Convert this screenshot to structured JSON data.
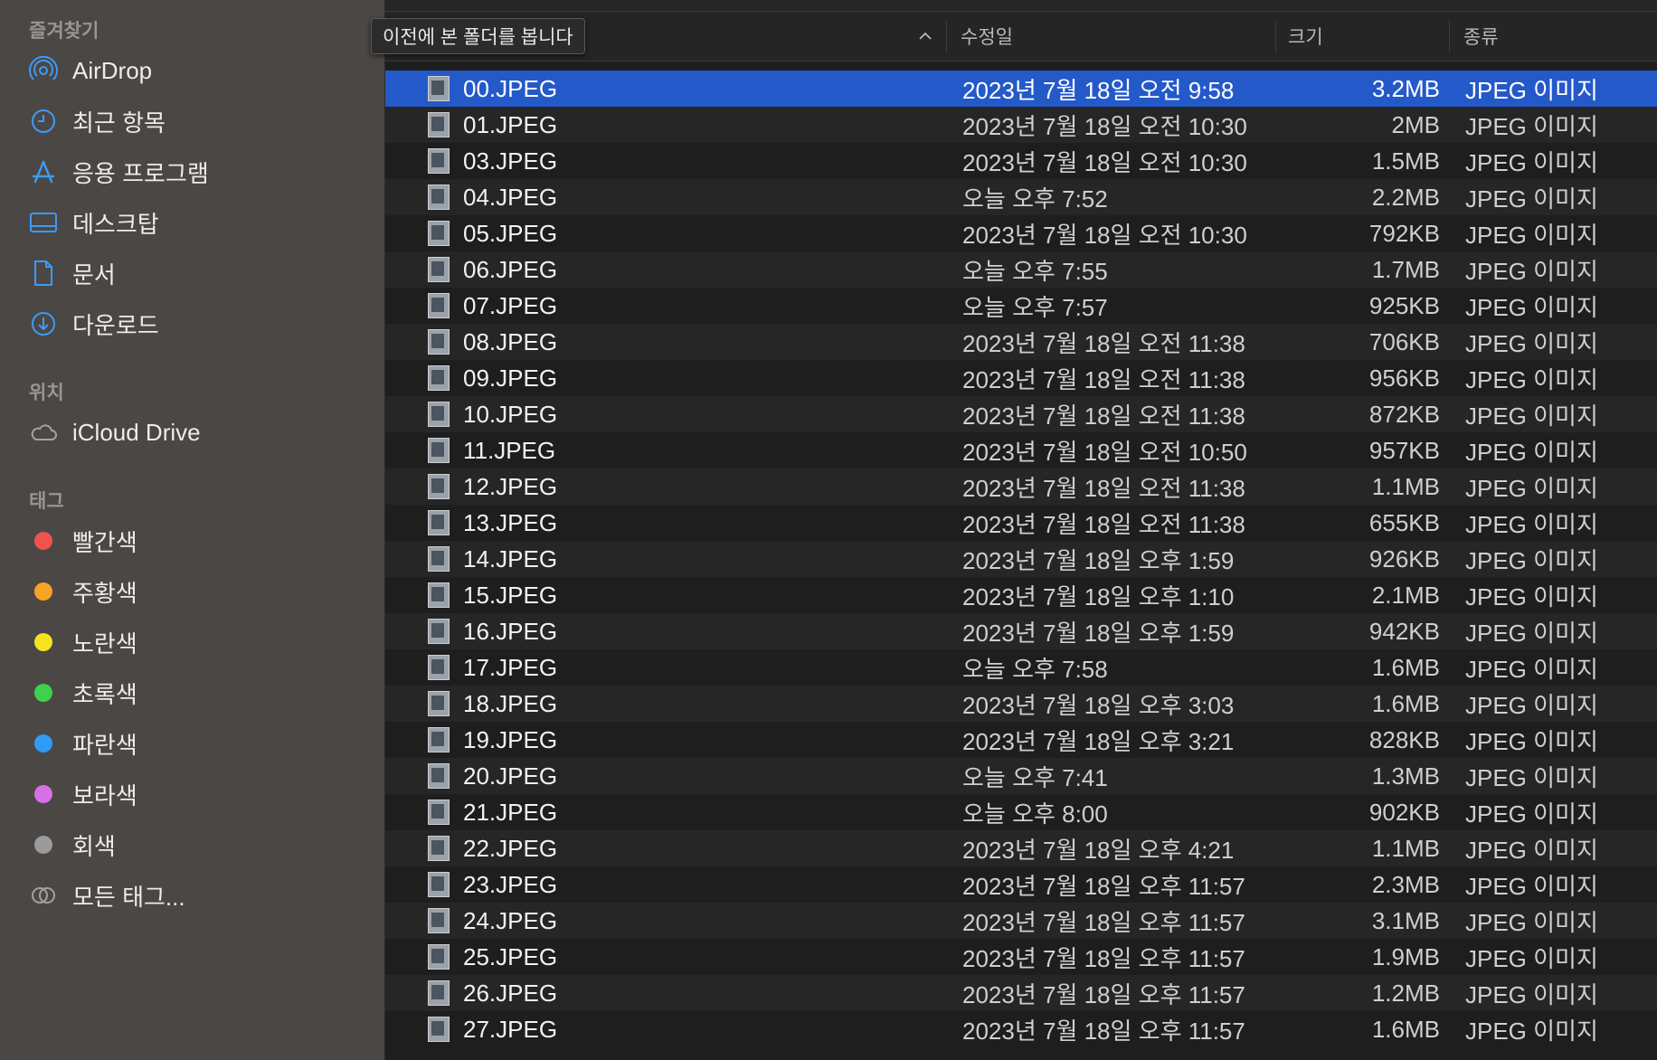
{
  "tooltip": "이전에 본 폴더를 봅니다",
  "sidebar": {
    "favorites_title": "즐겨찾기",
    "favorites": [
      {
        "label": "AirDrop",
        "icon": "airdrop-icon"
      },
      {
        "label": "최근 항목",
        "icon": "clock-icon"
      },
      {
        "label": "응용 프로그램",
        "icon": "applications-icon"
      },
      {
        "label": "데스크탑",
        "icon": "desktop-icon"
      },
      {
        "label": "문서",
        "icon": "document-icon"
      },
      {
        "label": "다운로드",
        "icon": "download-icon"
      }
    ],
    "locations_title": "위치",
    "locations": [
      {
        "label": "iCloud Drive",
        "icon": "cloud-icon"
      }
    ],
    "tags_title": "태그",
    "tags": [
      {
        "label": "빨간색",
        "color": "#f0524f"
      },
      {
        "label": "주황색",
        "color": "#f6a424"
      },
      {
        "label": "노란색",
        "color": "#f6e21e"
      },
      {
        "label": "초록색",
        "color": "#3fd14d"
      },
      {
        "label": "파란색",
        "color": "#2f9bf4"
      },
      {
        "label": "보라색",
        "color": "#d86fe6"
      },
      {
        "label": "회색",
        "color": "#9b9b9b"
      },
      {
        "label": "모든 태그...",
        "color": ""
      }
    ]
  },
  "columns": {
    "date": "수정일",
    "size": "크기",
    "kind": "종류"
  },
  "files": [
    {
      "name": "00.JPEG",
      "date": "2023년 7월 18일 오전 9:58",
      "size": "3.2MB",
      "kind": "JPEG 이미지"
    },
    {
      "name": "01.JPEG",
      "date": "2023년 7월 18일 오전 10:30",
      "size": "2MB",
      "kind": "JPEG 이미지"
    },
    {
      "name": "03.JPEG",
      "date": "2023년 7월 18일 오전 10:30",
      "size": "1.5MB",
      "kind": "JPEG 이미지"
    },
    {
      "name": "04.JPEG",
      "date": "오늘 오후 7:52",
      "size": "2.2MB",
      "kind": "JPEG 이미지"
    },
    {
      "name": "05.JPEG",
      "date": "2023년 7월 18일 오전 10:30",
      "size": "792KB",
      "kind": "JPEG 이미지"
    },
    {
      "name": "06.JPEG",
      "date": "오늘 오후 7:55",
      "size": "1.7MB",
      "kind": "JPEG 이미지"
    },
    {
      "name": "07.JPEG",
      "date": "오늘 오후 7:57",
      "size": "925KB",
      "kind": "JPEG 이미지"
    },
    {
      "name": "08.JPEG",
      "date": "2023년 7월 18일 오전 11:38",
      "size": "706KB",
      "kind": "JPEG 이미지"
    },
    {
      "name": "09.JPEG",
      "date": "2023년 7월 18일 오전 11:38",
      "size": "956KB",
      "kind": "JPEG 이미지"
    },
    {
      "name": "10.JPEG",
      "date": "2023년 7월 18일 오전 11:38",
      "size": "872KB",
      "kind": "JPEG 이미지"
    },
    {
      "name": "11.JPEG",
      "date": "2023년 7월 18일 오전 10:50",
      "size": "957KB",
      "kind": "JPEG 이미지"
    },
    {
      "name": "12.JPEG",
      "date": "2023년 7월 18일 오전 11:38",
      "size": "1.1MB",
      "kind": "JPEG 이미지"
    },
    {
      "name": "13.JPEG",
      "date": "2023년 7월 18일 오전 11:38",
      "size": "655KB",
      "kind": "JPEG 이미지"
    },
    {
      "name": "14.JPEG",
      "date": "2023년 7월 18일 오후 1:59",
      "size": "926KB",
      "kind": "JPEG 이미지"
    },
    {
      "name": "15.JPEG",
      "date": "2023년 7월 18일 오후 1:10",
      "size": "2.1MB",
      "kind": "JPEG 이미지"
    },
    {
      "name": "16.JPEG",
      "date": "2023년 7월 18일 오후 1:59",
      "size": "942KB",
      "kind": "JPEG 이미지"
    },
    {
      "name": "17.JPEG",
      "date": "오늘 오후 7:58",
      "size": "1.6MB",
      "kind": "JPEG 이미지"
    },
    {
      "name": "18.JPEG",
      "date": "2023년 7월 18일 오후 3:03",
      "size": "1.6MB",
      "kind": "JPEG 이미지"
    },
    {
      "name": "19.JPEG",
      "date": "2023년 7월 18일 오후 3:21",
      "size": "828KB",
      "kind": "JPEG 이미지"
    },
    {
      "name": "20.JPEG",
      "date": "오늘 오후 7:41",
      "size": "1.3MB",
      "kind": "JPEG 이미지"
    },
    {
      "name": "21.JPEG",
      "date": "오늘 오후 8:00",
      "size": "902KB",
      "kind": "JPEG 이미지"
    },
    {
      "name": "22.JPEG",
      "date": "2023년 7월 18일 오후 4:21",
      "size": "1.1MB",
      "kind": "JPEG 이미지"
    },
    {
      "name": "23.JPEG",
      "date": "2023년 7월 18일 오후 11:57",
      "size": "2.3MB",
      "kind": "JPEG 이미지"
    },
    {
      "name": "24.JPEG",
      "date": "2023년 7월 18일 오후 11:57",
      "size": "3.1MB",
      "kind": "JPEG 이미지"
    },
    {
      "name": "25.JPEG",
      "date": "2023년 7월 18일 오후 11:57",
      "size": "1.9MB",
      "kind": "JPEG 이미지"
    },
    {
      "name": "26.JPEG",
      "date": "2023년 7월 18일 오후 11:57",
      "size": "1.2MB",
      "kind": "JPEG 이미지"
    },
    {
      "name": "27.JPEG",
      "date": "2023년 7월 18일 오후 11:57",
      "size": "1.6MB",
      "kind": "JPEG 이미지"
    }
  ]
}
